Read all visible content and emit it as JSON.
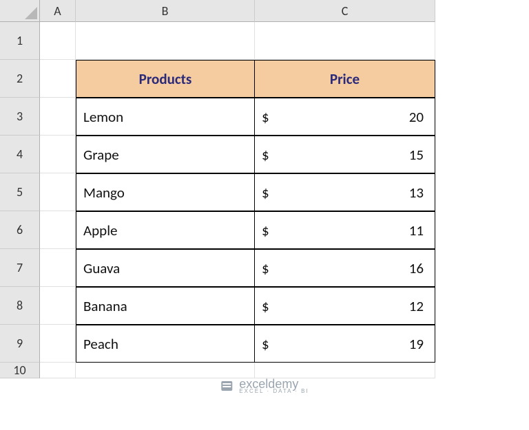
{
  "columns": {
    "A": "A",
    "B": "B",
    "C": "C"
  },
  "row_labels": [
    "1",
    "2",
    "3",
    "4",
    "5",
    "6",
    "7",
    "8",
    "9",
    "10"
  ],
  "table": {
    "headers": {
      "products": "Products",
      "price": "Price"
    },
    "currency_symbol": "$",
    "rows": [
      {
        "product": "Lemon",
        "price": "20"
      },
      {
        "product": "Grape",
        "price": "15"
      },
      {
        "product": "Mango",
        "price": "13"
      },
      {
        "product": "Apple",
        "price": "11"
      },
      {
        "product": "Guava",
        "price": "16"
      },
      {
        "product": "Banana",
        "price": "12"
      },
      {
        "product": "Peach",
        "price": "19"
      }
    ]
  },
  "watermark": {
    "name": "exceldemy",
    "tagline": "EXCEL · DATA · BI"
  }
}
